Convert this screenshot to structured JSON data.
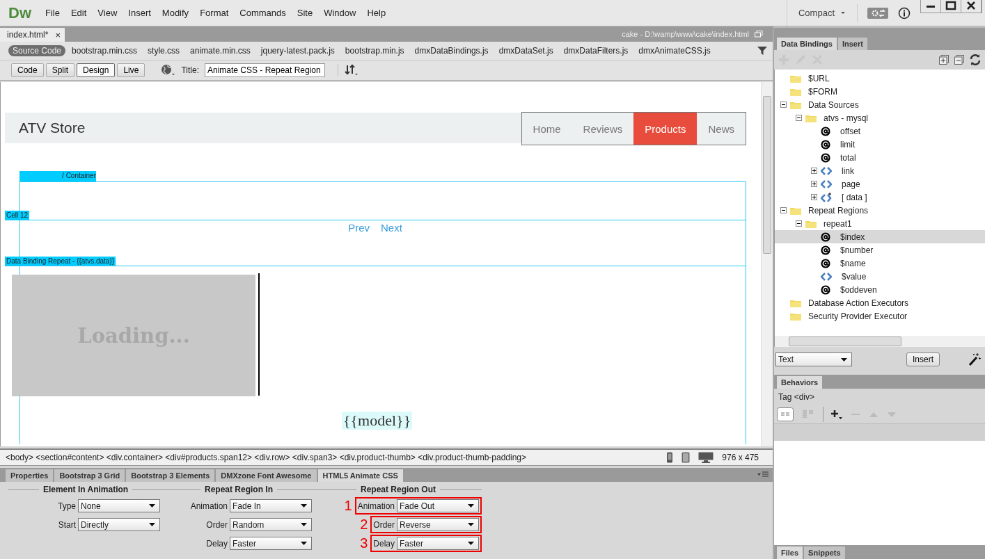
{
  "app": {
    "logo": "Dw",
    "menu": [
      "File",
      "Edit",
      "View",
      "Insert",
      "Modify",
      "Format",
      "Commands",
      "Site",
      "Window",
      "Help"
    ],
    "workspace": "Compact"
  },
  "document": {
    "tab": "index.html*",
    "close": "×",
    "path": "cake - D:\\wamp\\www\\cake\\index.html"
  },
  "related_files": [
    {
      "label": "Source Code",
      "selected": true
    },
    {
      "label": "bootstrap.min.css",
      "selected": false
    },
    {
      "label": "style.css",
      "selected": false
    },
    {
      "label": "animate.min.css",
      "selected": false
    },
    {
      "label": "jquery-latest.pack.js",
      "selected": false
    },
    {
      "label": "bootstrap.min.js",
      "selected": false
    },
    {
      "label": "dmxDataBindings.js",
      "selected": false
    },
    {
      "label": "dmxDataSet.js",
      "selected": false
    },
    {
      "label": "dmxDataFilters.js",
      "selected": false
    },
    {
      "label": "dmxAnimateCSS.js",
      "selected": false
    }
  ],
  "view_buttons": [
    {
      "label": "Code",
      "selected": false
    },
    {
      "label": "Split",
      "selected": false
    },
    {
      "label": "Design",
      "selected": true
    },
    {
      "label": "Live",
      "selected": false
    }
  ],
  "title_field": {
    "label": "Title:",
    "value": "Animate CSS - Repeat Region"
  },
  "page": {
    "brand": "ATV Store",
    "nav": [
      {
        "label": "Home",
        "selected": false
      },
      {
        "label": "Reviews",
        "selected": false
      },
      {
        "label": "Products",
        "selected": true
      },
      {
        "label": "News",
        "selected": false
      }
    ],
    "container_label": "/ Container",
    "cell_label": "Cell 12",
    "pager": [
      "Prev",
      "Next"
    ],
    "repeat_label": "Data Binding Repeat - {{atvs.data}}",
    "image_placeholder": "Loading...",
    "binding": "{{model}}"
  },
  "tag_selector": "<body> <section#content> <div.container> <div#products.span12> <div.row> <div.span3> <div.product-thumb> <div.product-thumb-padding>",
  "window_size": "976 x 475",
  "panel_tabs": [
    {
      "label": "Properties",
      "selected": false
    },
    {
      "label": "Bootstrap 3 Grid",
      "selected": false
    },
    {
      "label": "Bootstrap 3 Elements",
      "selected": false
    },
    {
      "label": "DMXzone Font Awesome",
      "selected": false
    },
    {
      "label": "HTML5 Animate CSS",
      "selected": true
    }
  ],
  "property_groups": [
    {
      "title": "Element In Animation",
      "fields": [
        {
          "label": "Type",
          "value": "None",
          "highlighted": false
        },
        {
          "label": "Start",
          "value": "Directly",
          "highlighted": false
        }
      ]
    },
    {
      "title": "Repeat Region In",
      "fields": [
        {
          "label": "Animation",
          "value": "Fade In",
          "highlighted": false
        },
        {
          "label": "Order",
          "value": "Random",
          "highlighted": false
        },
        {
          "label": "Delay",
          "value": "Faster",
          "highlighted": false
        }
      ]
    },
    {
      "title": "Repeat Region Out",
      "fields": [
        {
          "label": "Animation",
          "value": "Fade Out",
          "highlighted": true,
          "marker": "1"
        },
        {
          "label": "Order",
          "value": "Reverse",
          "highlighted": true,
          "marker": "2"
        },
        {
          "label": "Delay",
          "value": "Faster",
          "highlighted": true,
          "marker": "3"
        }
      ]
    }
  ],
  "right_panel": {
    "tabs": [
      {
        "label": "Data Bindings",
        "selected": true
      },
      {
        "label": "Insert",
        "selected": false
      }
    ],
    "tree": [
      {
        "label": "$URL",
        "kind": "folder",
        "selected": false
      },
      {
        "label": "$FORM",
        "kind": "folder",
        "selected": false
      },
      {
        "label": "Data Sources",
        "kind": "folder",
        "selected": false,
        "expanded": true,
        "children": [
          {
            "label": "atvs - mysql",
            "kind": "folder",
            "selected": false,
            "expanded": true,
            "children": [
              {
                "label": "offset",
                "kind": "field",
                "selected": false
              },
              {
                "label": "limit",
                "kind": "field",
                "selected": false
              },
              {
                "label": "total",
                "kind": "field",
                "selected": false
              },
              {
                "label": "link",
                "kind": "object",
                "selected": false,
                "expanded": false
              },
              {
                "label": "page",
                "kind": "object",
                "selected": false,
                "expanded": false
              },
              {
                "label": "[ data ]",
                "kind": "array",
                "selected": false,
                "expanded": false
              }
            ]
          }
        ]
      },
      {
        "label": "Repeat Regions",
        "kind": "folder",
        "selected": false,
        "expanded": true,
        "children": [
          {
            "label": "repeat1",
            "kind": "folder",
            "selected": false,
            "expanded": true,
            "children": [
              {
                "label": "$index",
                "kind": "field",
                "selected": true
              },
              {
                "label": "$number",
                "kind": "field",
                "selected": false
              },
              {
                "label": "$name",
                "kind": "field",
                "selected": false
              },
              {
                "label": "$value",
                "kind": "object",
                "selected": false
              },
              {
                "label": "$oddeven",
                "kind": "field",
                "selected": false
              }
            ]
          }
        ]
      },
      {
        "label": "Database Action Executors",
        "kind": "folder",
        "selected": false
      },
      {
        "label": "Security Provider Executor",
        "kind": "folder",
        "selected": false
      }
    ],
    "insert_type": "Text",
    "insert_button": "Insert",
    "behaviors_tab": "Behaviors",
    "tag": "Tag <div>",
    "bottom_tabs": [
      {
        "label": "Files",
        "selected": true
      },
      {
        "label": "Snippets",
        "selected": false
      }
    ]
  }
}
